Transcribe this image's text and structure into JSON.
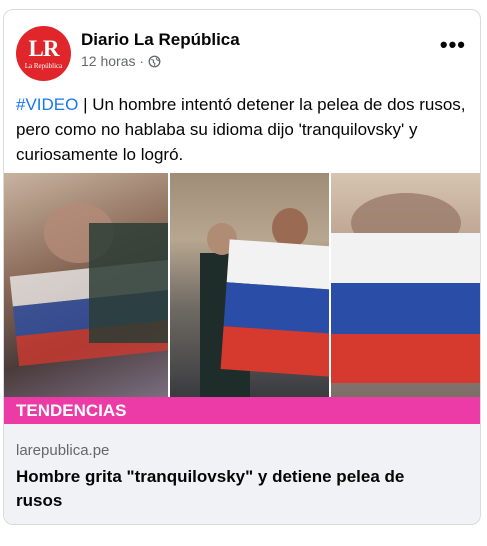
{
  "post": {
    "page_name": "Diario La República",
    "avatar_initials": "LR",
    "avatar_sub": "La República",
    "timestamp": "12 horas · ",
    "privacy_icon": "globe-icon",
    "more_icon": "more-options-icon",
    "more_label": "•••",
    "hashtag": "#VIDEO",
    "text": " | Un hombre intentó detener la pelea de dos rusos, pero como no hablaba su idioma dijo 'tranquilovsky' y curiosamente lo logró.",
    "brand_color": "#e0262b",
    "hashtag_color": "#1877f2"
  },
  "media": {
    "badge": "TENDENCIAS",
    "badge_color": "#ec3aa6"
  },
  "link": {
    "domain": "larepublica.pe",
    "title": "Hombre grita \"tranquilovsky\" y detiene pelea de rusos"
  }
}
